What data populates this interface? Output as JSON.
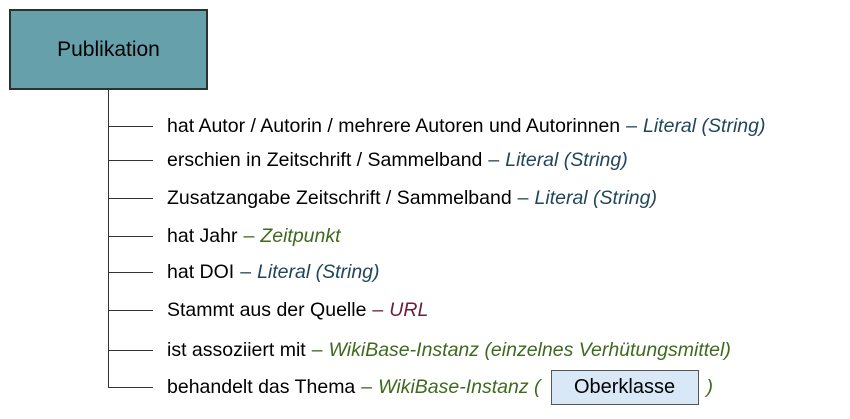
{
  "root": {
    "label": "Publikation",
    "fill": "#66a0ab"
  },
  "colors": {
    "literal": "#22475a",
    "zeitpunkt": "#3f6a1e",
    "url": "#6a1e3a",
    "wikibase": "#3f6a1e",
    "box_fill": "#d8e8f7"
  },
  "properties": [
    {
      "label": "hat Autor / Autorin / mehrere Autoren und Autorinnen",
      "dash": "–",
      "type": "Literal (String)",
      "kind": "literal"
    },
    {
      "label": "erschien in Zeitschrift / Sammelband",
      "dash": "–",
      "type": "Literal (String)",
      "kind": "literal"
    },
    {
      "label": "Zusatzangabe Zeitschrift / Sammelband",
      "dash": "–",
      "type": "Literal (String)",
      "kind": "literal"
    },
    {
      "label": "hat Jahr",
      "dash": "–",
      "type": "Zeitpunkt",
      "kind": "zeitpunkt"
    },
    {
      "label": "hat DOI",
      "dash": "–",
      "type": "Literal (String)",
      "kind": "literal"
    },
    {
      "label": "Stammt aus der Quelle",
      "dash": "–",
      "type": "URL",
      "kind": "url"
    },
    {
      "label": "ist assoziiert mit",
      "dash": "–",
      "type": "WikiBase-Instanz (einzelnes Verhütungsmittel)",
      "kind": "wikibase"
    },
    {
      "label": "behandelt das Thema",
      "dash": "–",
      "type": "WikiBase-Instanz (",
      "kind": "wikibase",
      "box": "Oberklasse",
      "suffix": ")"
    }
  ]
}
